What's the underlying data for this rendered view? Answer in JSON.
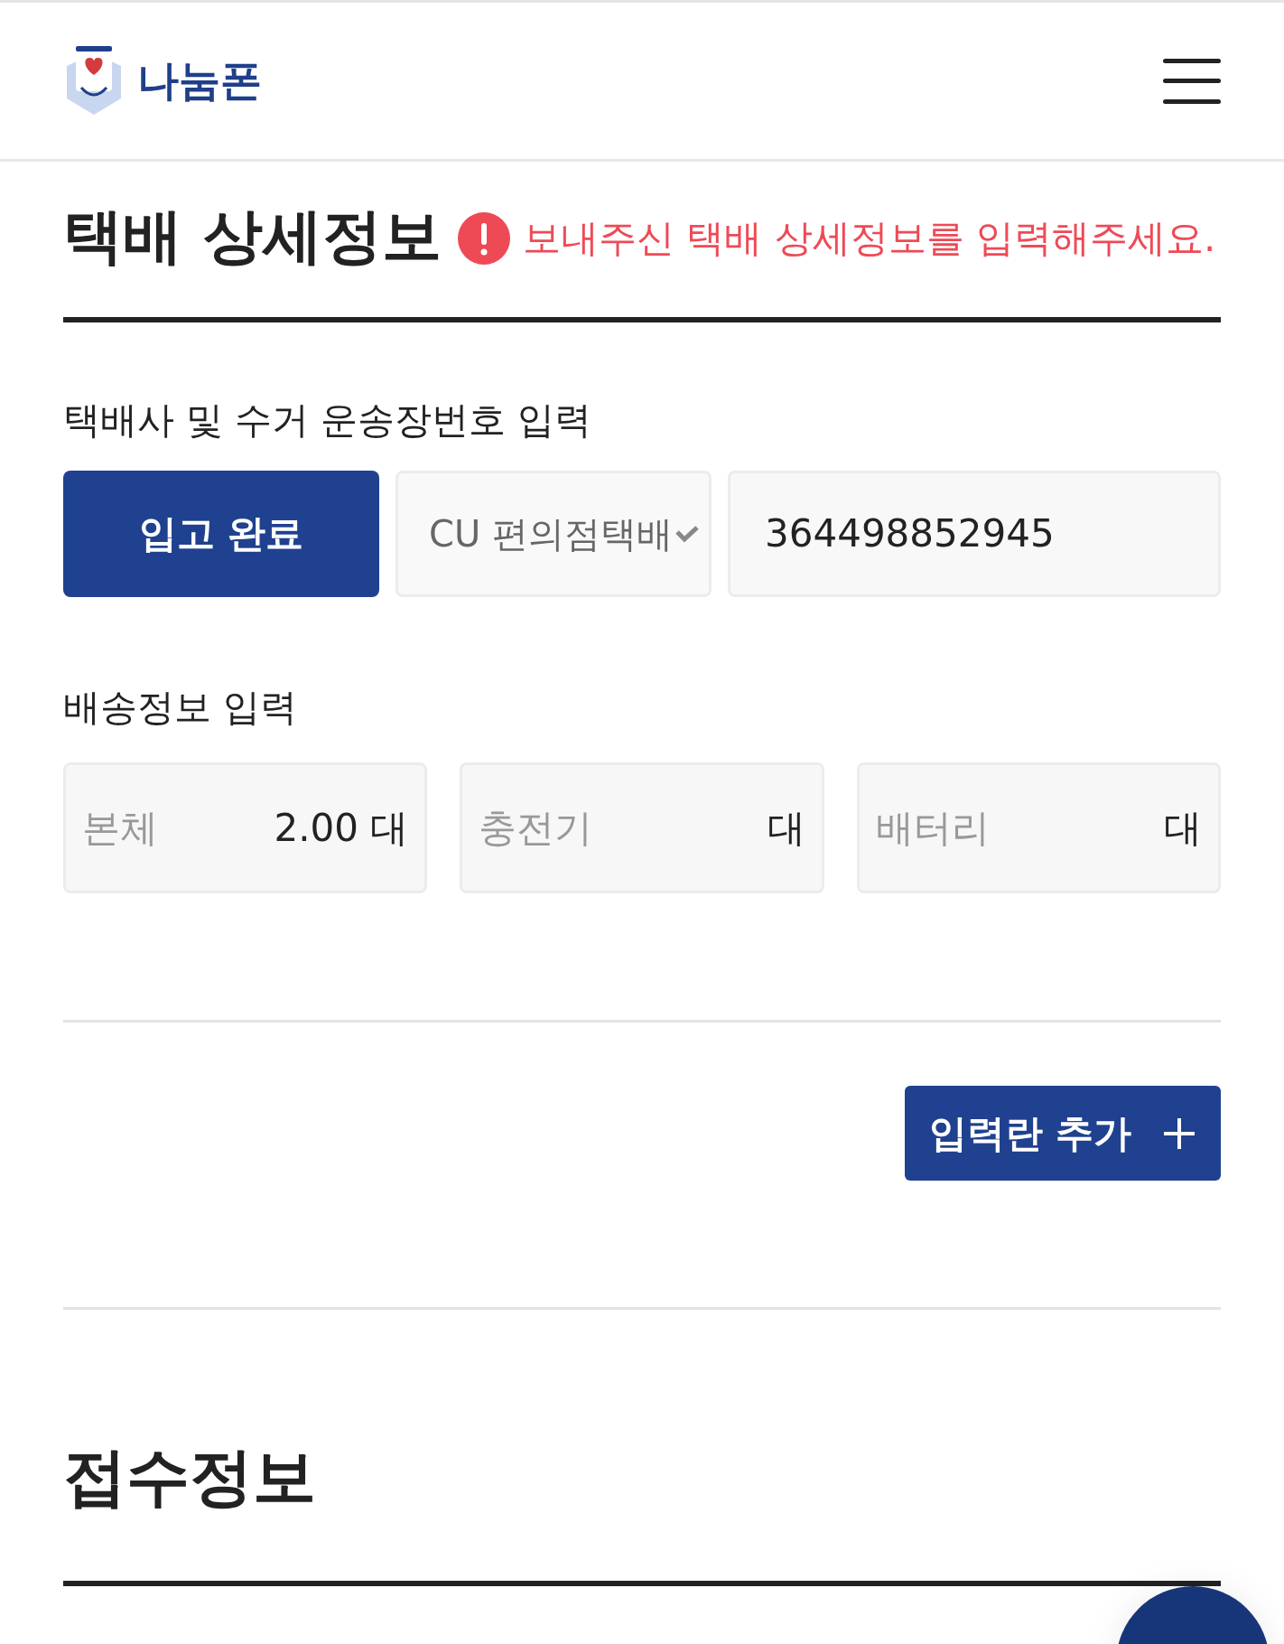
{
  "header": {
    "logo_text": "나눔폰"
  },
  "delivery_section": {
    "title": "택배 상세정보",
    "error": "보내주신 택배 상세정보를 입력해주세요.",
    "courier_label": "택배사 및 수거 운송장번호 입력",
    "status_button": "입고 완료",
    "courier_select": {
      "value": "CU 편의점택배"
    },
    "tracking_number": {
      "value": "364498852945"
    },
    "shipping_label": "배송정보 입력",
    "quantity_fields": [
      {
        "label": "본체",
        "value": "2.00",
        "unit": "대"
      },
      {
        "label": "충전기",
        "unit": "대"
      },
      {
        "label": "배터리",
        "unit": "대"
      }
    ],
    "add_button": "입력란 추가"
  },
  "receipt_section": {
    "title": "접수정보"
  }
}
